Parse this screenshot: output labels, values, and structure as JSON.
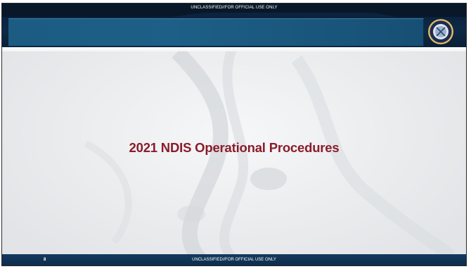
{
  "header": {
    "classification": "UNCLASSIFIED//FOR OFFICIAL USE ONLY",
    "logo_icon": "codis-seal-icon"
  },
  "main": {
    "title": "2021 NDIS Operational Procedures"
  },
  "footer": {
    "page_number": "8",
    "classification": "UNCLASSIFIED//FOR OFFICIAL USE ONLY"
  },
  "colors": {
    "title": "#8a1c2b",
    "header_dark": "#0e2947",
    "header_band": "#1d5f86",
    "footer": "#0e2c4c",
    "background": "#e9eaec"
  }
}
